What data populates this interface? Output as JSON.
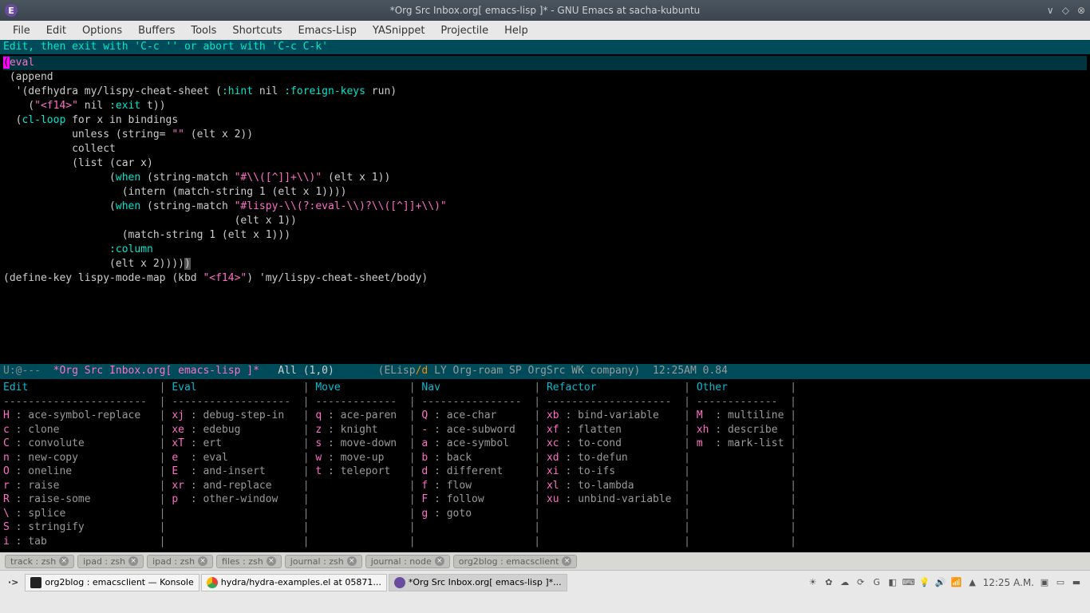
{
  "titlebar": {
    "title": "*Org Src Inbox.org[ emacs-lisp ]* - GNU Emacs at sacha-kubuntu"
  },
  "menubar": {
    "items": [
      "File",
      "Edit",
      "Options",
      "Buffers",
      "Tools",
      "Shortcuts",
      "Emacs-Lisp",
      "YASnippet",
      "Projectile",
      "Help"
    ]
  },
  "headerline": "Edit, then exit with 'C-c '' or abort with 'C-c C-k'",
  "code": {
    "l0a": "(",
    "l0b": "eval",
    "l1": " (append",
    "l2a": "  '(defhydra my/lispy-cheat-sheet (",
    "l2b": ":hint",
    "l2c": " nil ",
    "l2d": ":foreign-keys",
    "l2e": " run)",
    "l3a": "    (",
    "l3b": "\"<f14>\"",
    "l3c": " nil ",
    "l3d": ":exit",
    "l3e": " t))",
    "l4a": "  (",
    "l4b": "cl-loop",
    "l4c": " for x in bindings",
    "l5a": "           unless (string= ",
    "l5b": "\"\"",
    "l5c": " (elt x 2))",
    "l6": "           collect",
    "l7": "           (list (car x)",
    "l8a": "                 (",
    "l8b": "when",
    "l8c": " (string-match ",
    "l8d": "\"#\\\\([^]]+\\\\)\"",
    "l8e": " (elt x 1))",
    "l9": "                   (intern (match-string 1 (elt x 1))))",
    "l10a": "                 (",
    "l10b": "when",
    "l10c": " (string-match ",
    "l10d": "\"#lispy-\\\\(?:eval-\\\\)?\\\\([^]]+\\\\)\"",
    "l11": "                                     (elt x 1))",
    "l12": "                   (match-string 1 (elt x 1)))",
    "l13a": "                 ",
    "l13b": ":column",
    "l14a": "                 (elt x 2))))",
    "l14b": ")",
    "l15a": "(define-key lispy-mode-map (kbd ",
    "l15b": "\"<f14>\"",
    "l15c": ") 'my/lispy-cheat-sheet/body)"
  },
  "modeline": {
    "prefix": "U:@---  ",
    "buffer": "*Org Src Inbox.org[ emacs-lisp ]*",
    "pos": "   All (1,0)       ",
    "modes_a": "(ELisp",
    "modes_slash": "/d",
    "modes_b": " LY Org-roam SP OrgSrc WK company)",
    "time": "  12:25AM 0.84"
  },
  "hydra": {
    "headers": [
      "Edit",
      "Eval",
      "Move",
      "Nav",
      "Refactor",
      "Other"
    ],
    "col_edit": [
      {
        "k": "H",
        "c": "ace-symbol-replace"
      },
      {
        "k": "c",
        "c": "clone"
      },
      {
        "k": "C",
        "c": "convolute"
      },
      {
        "k": "n",
        "c": "new-copy"
      },
      {
        "k": "O",
        "c": "oneline"
      },
      {
        "k": "r",
        "c": "raise"
      },
      {
        "k": "R",
        "c": "raise-some"
      },
      {
        "k": "\\",
        "c": "splice"
      },
      {
        "k": "S",
        "c": "stringify"
      },
      {
        "k": "i",
        "c": "tab"
      }
    ],
    "col_eval": [
      {
        "k": "xj",
        "c": "debug-step-in"
      },
      {
        "k": "xe",
        "c": "edebug"
      },
      {
        "k": "xT",
        "c": "ert"
      },
      {
        "k": "e",
        "c": "eval"
      },
      {
        "k": "E",
        "c": "and-insert"
      },
      {
        "k": "xr",
        "c": "and-replace"
      },
      {
        "k": "p",
        "c": "other-window"
      }
    ],
    "col_move": [
      {
        "k": "q",
        "c": "ace-paren"
      },
      {
        "k": "z",
        "c": "knight"
      },
      {
        "k": "s",
        "c": "move-down"
      },
      {
        "k": "w",
        "c": "move-up"
      },
      {
        "k": "t",
        "c": "teleport"
      }
    ],
    "col_nav": [
      {
        "k": "Q",
        "c": "ace-char"
      },
      {
        "k": "-",
        "c": "ace-subword"
      },
      {
        "k": "a",
        "c": "ace-symbol"
      },
      {
        "k": "b",
        "c": "back"
      },
      {
        "k": "d",
        "c": "different"
      },
      {
        "k": "f",
        "c": "flow"
      },
      {
        "k": "F",
        "c": "follow"
      },
      {
        "k": "g",
        "c": "goto"
      }
    ],
    "col_refactor": [
      {
        "k": "xb",
        "c": "bind-variable"
      },
      {
        "k": "xf",
        "c": "flatten"
      },
      {
        "k": "xc",
        "c": "to-cond"
      },
      {
        "k": "xd",
        "c": "to-defun"
      },
      {
        "k": "xi",
        "c": "to-ifs"
      },
      {
        "k": "xl",
        "c": "to-lambda"
      },
      {
        "k": "xu",
        "c": "unbind-variable"
      }
    ],
    "col_other": [
      {
        "k": "M",
        "c": "multiline"
      },
      {
        "k": "xh",
        "c": "describe"
      },
      {
        "k": "m",
        "c": "mark-list"
      }
    ]
  },
  "bg_tabs": [
    "track : zsh",
    "ipad : zsh",
    "ipad : zsh",
    "files : zsh",
    "journal : zsh",
    "journal : node",
    "org2blog : emacsclient"
  ],
  "taskbar": {
    "items": [
      {
        "icon": "konsole",
        "label": "org2blog : emacsclient — Konsole"
      },
      {
        "icon": "chrome",
        "label": "hydra/hydra-examples.el at 05871..."
      },
      {
        "icon": "emacs",
        "label": "*Org Src Inbox.org[ emacs-lisp ]*..."
      }
    ],
    "clock": "12:25 A.M."
  }
}
